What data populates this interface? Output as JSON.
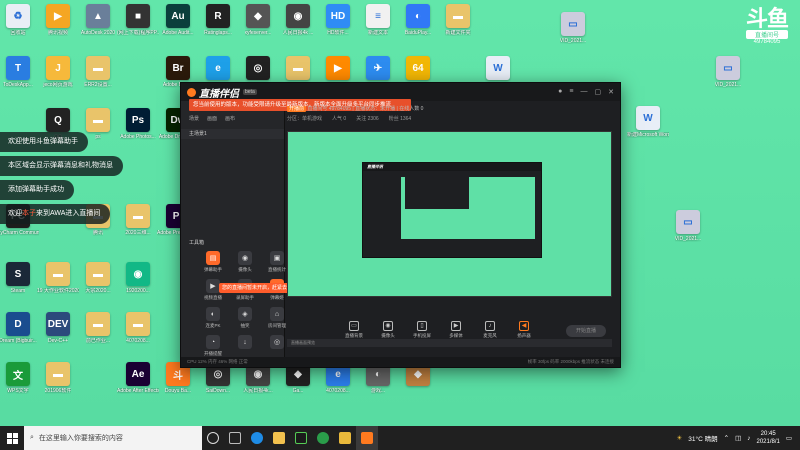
{
  "desktop": {
    "watermark": {
      "brand": "斗鱼",
      "line1": "直播间号",
      "line2": "49784095"
    },
    "icons": [
      {
        "label": "回收站",
        "glyph": "♻",
        "color": "#e8eef5"
      },
      {
        "label": "腾讯视频",
        "glyph": "▶",
        "color": "#f5a623"
      },
      {
        "label": "AutoDesk 2020",
        "glyph": "▲",
        "color": "#6a7f9a"
      },
      {
        "label": "(网上下载)程序PP...",
        "glyph": "■",
        "color": "#333"
      },
      {
        "label": "Adobe Audit...",
        "glyph": "Au",
        "color": "#0b3f3c"
      },
      {
        "label": "Ratinglaps...",
        "glyph": "R",
        "color": "#222"
      },
      {
        "label": "xyfeserver...",
        "glyph": "◆",
        "color": "#555"
      },
      {
        "label": "人民日报4k ...",
        "glyph": "◉",
        "color": "#444"
      },
      {
        "label": "HD软件...",
        "glyph": "HD",
        "color": "#2f8cf5"
      },
      {
        "label": "新建文本",
        "glyph": "≡",
        "color": "#f1f1f1"
      },
      {
        "label": "BaiduPlay...",
        "glyph": "◐",
        "color": "#3178f6"
      },
      {
        "label": "新建文件夹",
        "glyph": "▬",
        "color": "#e9c46a"
      },
      {
        "label": "ToDeskApp...",
        "glyph": "T",
        "color": "#2a7de1"
      },
      {
        "label": "jeco网页游戏",
        "glyph": "J",
        "color": "#f6b93b"
      },
      {
        "label": "ERR2设置...",
        "glyph": "▬",
        "color": "#e9c46a"
      },
      {
        "label": "Adobe Bridge",
        "glyph": "Br",
        "color": "#2b1a0b"
      },
      {
        "label": "浏览器",
        "glyph": "e",
        "color": "#1ea0e9"
      },
      {
        "label": "Steam App",
        "glyph": "◎",
        "color": "#222"
      },
      {
        "label": "新建文件夹",
        "glyph": "▬",
        "color": "#e9c46a"
      },
      {
        "label": "视频播放器",
        "glyph": "▶",
        "color": "#ff8a00"
      },
      {
        "label": "飞书",
        "glyph": "✈",
        "color": "#2d8cf0"
      },
      {
        "label": "方框软件",
        "glyph": "64",
        "color": "#f2b705"
      },
      {
        "label": "新建文档",
        "glyph": "W",
        "color": "#e8eef7"
      },
      {
        "label": "QQ",
        "glyph": "Q",
        "color": "#222"
      },
      {
        "label": "ps",
        "glyph": "▬",
        "color": "#e9c46a"
      },
      {
        "label": "Adobe Photos...",
        "glyph": "Ps",
        "color": "#001d34"
      },
      {
        "label": "Adobe Dreamw...",
        "glyph": "Dw",
        "color": "#072401"
      },
      {
        "label": "PyCharm Communit...",
        "glyph": "PC",
        "color": "#1d1d1d"
      },
      {
        "label": "腾讯",
        "glyph": "▬",
        "color": "#e9c46a"
      },
      {
        "label": "2020三维...",
        "glyph": "▬",
        "color": "#e9c46a"
      },
      {
        "label": "Adobe Premiere Pro...",
        "glyph": "Pr",
        "color": "#1a0033"
      },
      {
        "label": "Steam",
        "glyph": "S",
        "color": "#1b2838"
      },
      {
        "label": "19 大作业软件2020...",
        "glyph": "▬",
        "color": "#e9c46a"
      },
      {
        "label": "大宗2020...",
        "glyph": "▬",
        "color": "#e9c46a"
      },
      {
        "label": "1920200...",
        "glyph": "◉",
        "color": "#12b886"
      },
      {
        "label": "Dream (Bigbuir...",
        "glyph": "D",
        "color": "#1a4d8f"
      },
      {
        "label": "Dev-C++",
        "glyph": "DEV",
        "color": "#2c4a7c"
      },
      {
        "label": "前已作业...",
        "glyph": "▬",
        "color": "#e9c46a"
      },
      {
        "label": "4070208...",
        "glyph": "▬",
        "color": "#e9c46a"
      },
      {
        "label": "WPS文字",
        "glyph": "文",
        "color": "#1a9b3a"
      },
      {
        "label": "201906软件",
        "glyph": "▬",
        "color": "#e9c46a"
      },
      {
        "label": "Adobe After Effects 2020",
        "glyph": "Ae",
        "color": "#1a0033"
      },
      {
        "label": "Douyu Ba...",
        "glyph": "斗",
        "color": "#ff7a1f"
      },
      {
        "label": "SaiDown...",
        "glyph": "◎",
        "color": "#333"
      },
      {
        "label": "人民日报4k...",
        "glyph": "◉",
        "color": "#444"
      },
      {
        "label": "Ga...",
        "glyph": "◆",
        "color": "#222"
      },
      {
        "label": "4070208...",
        "glyph": "e",
        "color": "#2b7de9"
      },
      {
        "label": "游戏...",
        "glyph": "◐",
        "color": "#666"
      },
      {
        "label": "",
        "glyph": "◆",
        "color": "#c08040"
      },
      {
        "label": "VID_2021...",
        "glyph": "▭",
        "color": "#ccd"
      },
      {
        "label": "VID_2021...",
        "glyph": "▭",
        "color": "#ccd"
      },
      {
        "label": "新建Microsoft Word 文档",
        "glyph": "W",
        "color": "#e8eef7"
      },
      {
        "label": "VID_2021...",
        "glyph": "▭",
        "color": "#ccd"
      }
    ]
  },
  "toasts": [
    {
      "pre": "欢迎使用斗鱼弹幕助手",
      "red": "",
      "post": ""
    },
    {
      "pre": "本区域会显示弹幕消息和礼物消息",
      "red": "",
      "post": ""
    },
    {
      "pre": "添加弹幕助手成功",
      "red": "",
      "post": ""
    },
    {
      "pre": "欢迎",
      "red": "本子",
      "post": "来到AWA进入直播间"
    }
  ],
  "app": {
    "title": "直播伴侣",
    "beta": "beta",
    "notice": "您当前使用的版本，功能受限请升级至最新版本，新版本全面升级多平台同步推流",
    "scene_tabs": [
      "场景",
      "画面",
      "画布"
    ],
    "scene_name": "主场景1",
    "add_source": "工具箱",
    "tools": [
      {
        "label": "弹幕助手",
        "glyph": "▤",
        "active": true
      },
      {
        "label": "摄像头",
        "glyph": "◉",
        "active": false
      },
      {
        "label": "直播统计",
        "glyph": "▣",
        "active": false
      },
      {
        "label": "视频直播",
        "glyph": "▶",
        "active": false
      },
      {
        "label": "录屏助手",
        "glyph": "◫",
        "active": false
      },
      {
        "label": "弹幕姬",
        "glyph": "✎",
        "active": true
      },
      {
        "label": "连麦PK",
        "glyph": "◐",
        "active": false
      },
      {
        "label": "抽奖",
        "glyph": "◈",
        "active": false
      },
      {
        "label": "房间管理",
        "glyph": "⌂",
        "active": false
      },
      {
        "label": "开播提醒",
        "glyph": "◔",
        "active": false
      },
      {
        "label": "",
        "glyph": "↓",
        "active": false
      },
      {
        "label": "",
        "glyph": "◎",
        "active": false
      }
    ],
    "popup": "您的直播间暂未开启，赶紧去开播吧～",
    "header": {
      "line1": "直播间号 49784095  |  直播状态：未开播  |  在线人数 0",
      "tag": "开播前",
      "stats": [
        "分区：单机游戏",
        "人气 0",
        "关注 2306",
        "粉丝 1364"
      ]
    },
    "preview_footer": "直播画面预览",
    "controls": [
      {
        "label": "直播背景",
        "glyph": "▭",
        "hl": false
      },
      {
        "label": "摄像头",
        "glyph": "◉",
        "hl": false
      },
      {
        "label": "手机投屏",
        "glyph": "▯",
        "hl": false
      },
      {
        "label": "多媒体",
        "glyph": "▶",
        "hl": false
      },
      {
        "label": "麦克风",
        "glyph": "♪",
        "hl": false
      },
      {
        "label": "扬声器",
        "glyph": "◀",
        "hl": true
      }
    ],
    "go_live": "开始直播",
    "status": {
      "left": "CPU 12%  内存 46%  网络 正常",
      "right": "帧率 30fps  码率 2000kbps  推流状态 未连接"
    }
  },
  "taskbar": {
    "search_placeholder": "在这里输入你要搜索的内容",
    "weather": "31°C 晴朗",
    "time": "20:45",
    "date": "2021/8/1"
  }
}
